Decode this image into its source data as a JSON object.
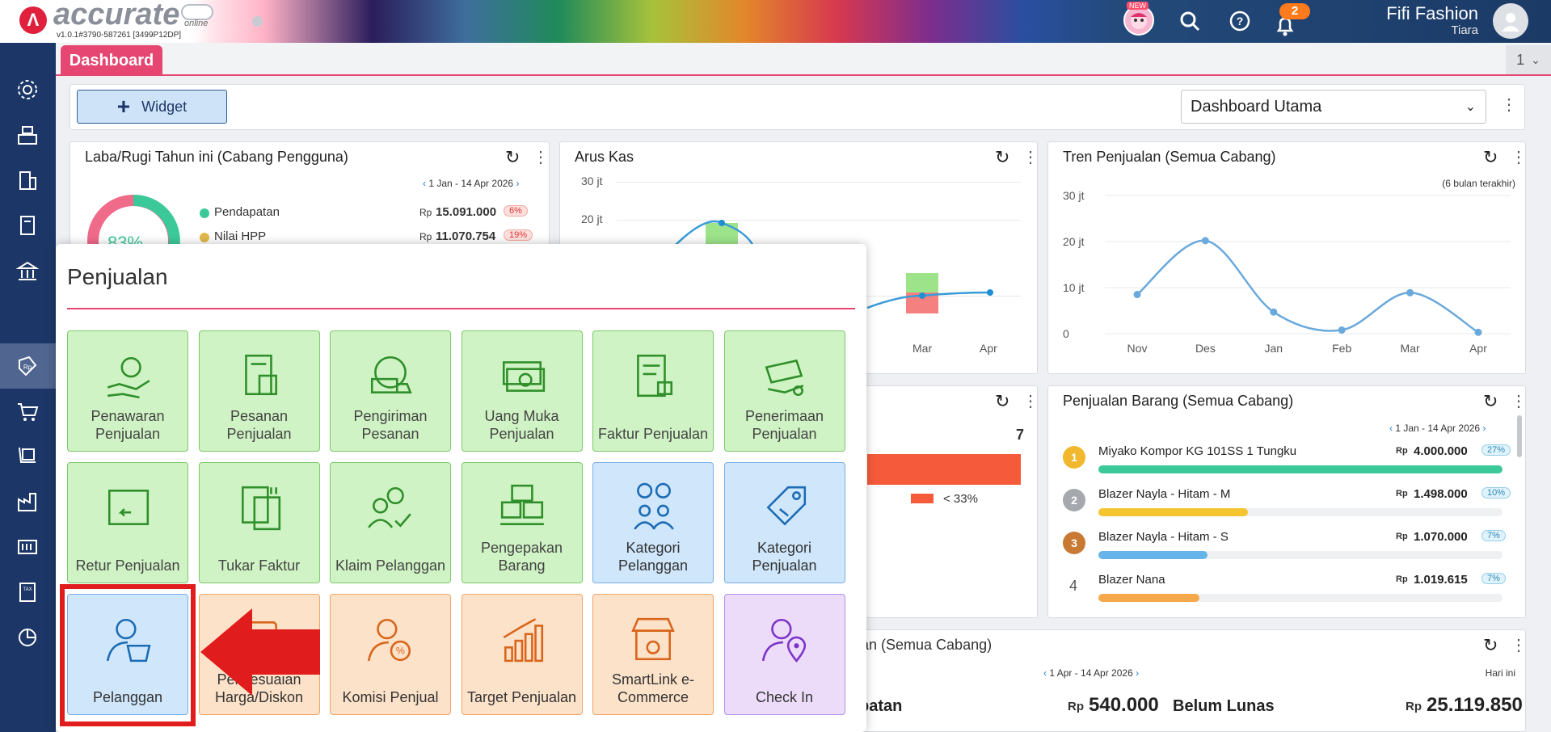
{
  "app": {
    "logo_text": "accurate",
    "logo_sub": "online",
    "version": "v1.0.1#3790-587261 [3499P12DP]",
    "new_badge": "NEW",
    "notif_count": "2",
    "user_name": "Fifi Fashion",
    "user_sub": "Tiara"
  },
  "tabs": {
    "dashboard": "Dashboard",
    "count": "1"
  },
  "toolbar": {
    "widget_label": "Widget",
    "select_value": "Dashboard Utama"
  },
  "laba": {
    "title": "Laba/Rugi Tahun ini (Cabang Pengguna)",
    "date_range": "1 Jan - 14 Apr 2026",
    "gauge": "83%",
    "rows": [
      {
        "label": "Pendapatan",
        "rp": "Rp",
        "value": "15.091.000",
        "pct": "6%",
        "color": "#3cc99a"
      },
      {
        "label": "Nilai HPP",
        "rp": "Rp",
        "value": "11.070.754",
        "pct": "19%",
        "color": "#e0b84a"
      }
    ]
  },
  "arus": {
    "title": "Arus Kas",
    "y_ticks": [
      "30 jt",
      "20 jt"
    ],
    "x_ticks": [
      "Mar",
      "Apr"
    ]
  },
  "tren": {
    "title": "Tren Penjualan (Semua Cabang)",
    "note": "(6 bulan terakhir)"
  },
  "chart_data": {
    "type": "line",
    "title": "Tren Penjualan (Semua Cabang)",
    "categories": [
      "Nov",
      "Des",
      "Jan",
      "Feb",
      "Mar",
      "Apr"
    ],
    "y_ticks": [
      "30 jt",
      "20 jt",
      "10 jt",
      "0"
    ],
    "values": [
      8.5,
      20.2,
      4.7,
      0.8,
      8.9,
      0.3
    ],
    "ylim": [
      0,
      30
    ],
    "grid": true,
    "color": "#6aa9dc"
  },
  "hidden_widget": {
    "value": "7",
    "legend": "< 33%"
  },
  "barang": {
    "title": "Penjualan Barang (Semua Cabang)",
    "date_range": "1 Jan - 14 Apr 2026",
    "items": [
      {
        "rank": "1",
        "name": "Miyako Kompor KG 101SS 1 Tungku",
        "rp": "Rp",
        "value": "4.000.000",
        "pct": "27%",
        "fill": 1.0,
        "color": "#3cc99a"
      },
      {
        "rank": "2",
        "name": "Blazer Nayla - Hitam - M",
        "rp": "Rp",
        "value": "1.498.000",
        "pct": "10%",
        "fill": 0.37,
        "color": "#f5c531"
      },
      {
        "rank": "3",
        "name": "Blazer Nayla - Hitam - S",
        "rp": "Rp",
        "value": "1.070.000",
        "pct": "7%",
        "fill": 0.27,
        "color": "#66b4ea"
      },
      {
        "rank": "4",
        "name": "Blazer Nana",
        "rp": "Rp",
        "value": "1.019.615",
        "pct": "7%",
        "fill": 0.25,
        "color": "#f5a94a"
      }
    ]
  },
  "piutang": {
    "title_fragment": "an (Semua Cabang)",
    "date_range": "1 Apr - 14 Apr 2026",
    "period": "Hari ini",
    "left_label": "patan",
    "left_rp": "Rp",
    "left_value": "540.000",
    "right_label": "Belum Lunas",
    "right_rp": "Rp",
    "right_value": "25.119.850"
  },
  "menu": {
    "title": "Penjualan",
    "tiles": [
      {
        "label": "Penawaran Penjualan",
        "icon": "hand-money-icon",
        "style": "green"
      },
      {
        "label": "Pesanan Penjualan",
        "icon": "order-doc-icon",
        "style": "green"
      },
      {
        "label": "Pengiriman Pesanan",
        "icon": "delivery-truck-icon",
        "style": "green"
      },
      {
        "label": "Uang Muka Penjualan",
        "icon": "cash-icon",
        "style": "green"
      },
      {
        "label": "Faktur Penjualan",
        "icon": "invoice-icon",
        "style": "green"
      },
      {
        "label": "Penerimaan Penjualan",
        "icon": "receive-payment-icon",
        "style": "green"
      },
      {
        "label": "Retur Penjualan",
        "icon": "return-box-icon",
        "style": "green"
      },
      {
        "label": "Tukar Faktur",
        "icon": "exchange-invoice-icon",
        "style": "green"
      },
      {
        "label": "Klaim Pelanggan",
        "icon": "claim-customer-icon",
        "style": "green"
      },
      {
        "label": "Pengepakan Barang",
        "icon": "packing-icon",
        "style": "green"
      },
      {
        "label": "Kategori Pelanggan",
        "icon": "customer-category-icon",
        "style": "blue"
      },
      {
        "label": "Kategori Penjualan",
        "icon": "sales-category-icon",
        "style": "blue"
      },
      {
        "label": "Pelanggan",
        "icon": "customer-basket-icon",
        "style": "blue"
      },
      {
        "label": "Penyesuaian Harga/Diskon",
        "icon": "price-adjust-icon",
        "style": "orange"
      },
      {
        "label": "Komisi Penjual",
        "icon": "commission-icon",
        "style": "orange"
      },
      {
        "label": "Target Penjualan",
        "icon": "target-chart-icon",
        "style": "orange"
      },
      {
        "label": "SmartLink e-Commerce",
        "icon": "store-icon",
        "style": "orange"
      },
      {
        "label": "Check In",
        "icon": "check-in-icon",
        "style": "purple"
      }
    ]
  }
}
